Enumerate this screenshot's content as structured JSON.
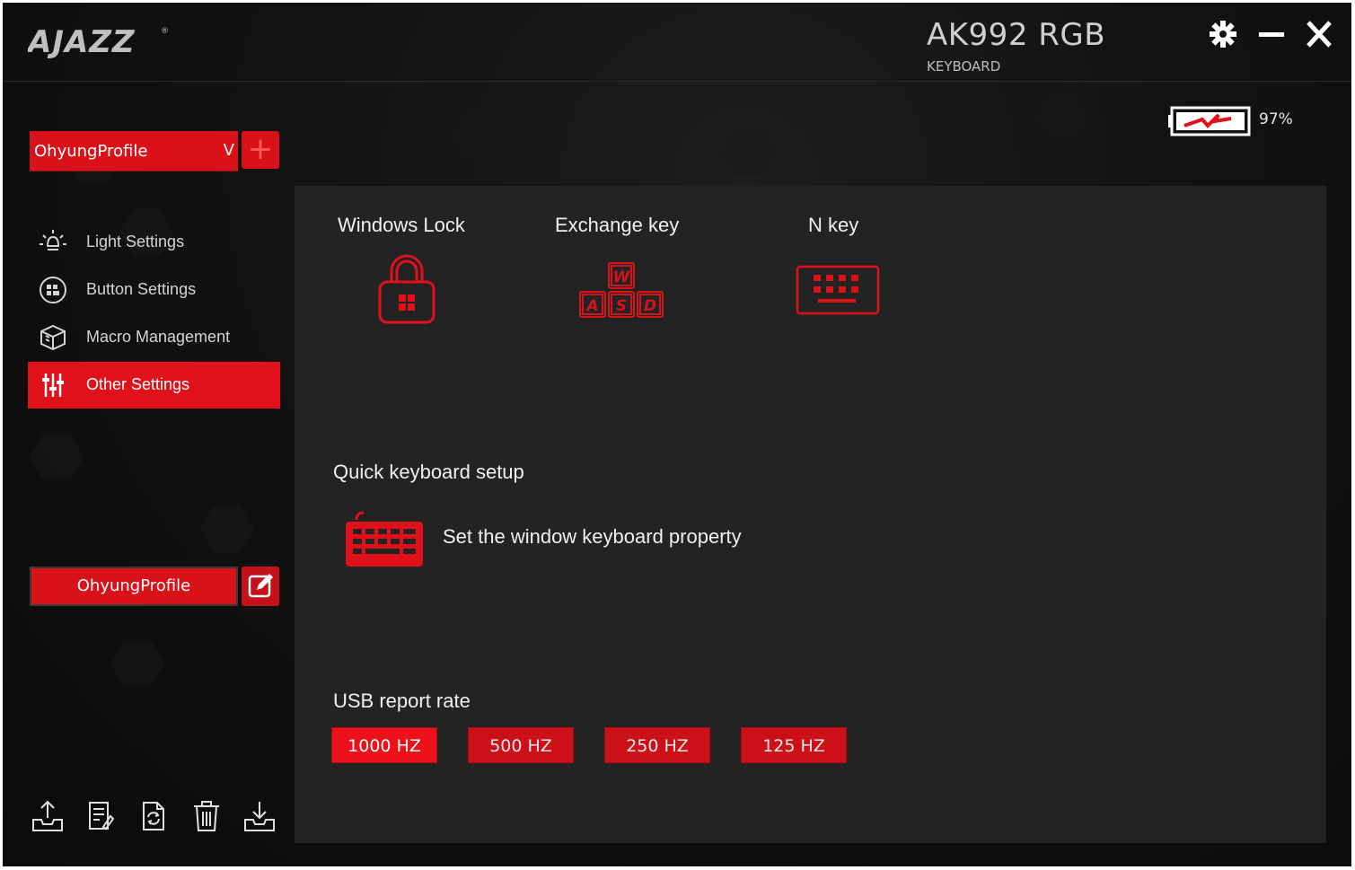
{
  "header": {
    "device_name": "AK992 RGB",
    "device_type": "KEYBOARD",
    "battery_percent": "97%",
    "battery_level": 0.97
  },
  "sidebar": {
    "profile_selected": "OhyungProfile",
    "profile_chevron": "V",
    "add_label": "+",
    "items": [
      {
        "label": "Light Settings",
        "icon": "light-bulb-icon"
      },
      {
        "label": "Button Settings",
        "icon": "button-grid-icon"
      },
      {
        "label": "Macro Management",
        "icon": "cube-icon"
      },
      {
        "label": "Other Settings",
        "icon": "sliders-icon"
      }
    ],
    "active_item": "Other Settings",
    "current_profile": "OhyungProfile",
    "bottom_icons": [
      "export-icon",
      "notes-icon",
      "refresh-file-icon",
      "trash-icon",
      "import-icon"
    ]
  },
  "main": {
    "options": [
      {
        "label": "Windows Lock",
        "icon": "windows-lock-icon"
      },
      {
        "label": "Exchange key",
        "icon": "wasd-icon"
      },
      {
        "label": "N key",
        "icon": "keyboard-icon"
      }
    ],
    "wasd": {
      "w": "W",
      "a": "A",
      "s": "S",
      "d": "D"
    },
    "quick_setup_title": "Quick keyboard setup",
    "quick_setup_text": "Set the window keyboard property",
    "usb_title": "USB report rate",
    "usb_rates": [
      "1000 HZ",
      "500 HZ",
      "250 HZ",
      "125 HZ"
    ],
    "usb_selected": "1000 HZ"
  },
  "colors": {
    "accent": "#e0111a",
    "background": "#0d0d0d",
    "panel": "#232323"
  }
}
